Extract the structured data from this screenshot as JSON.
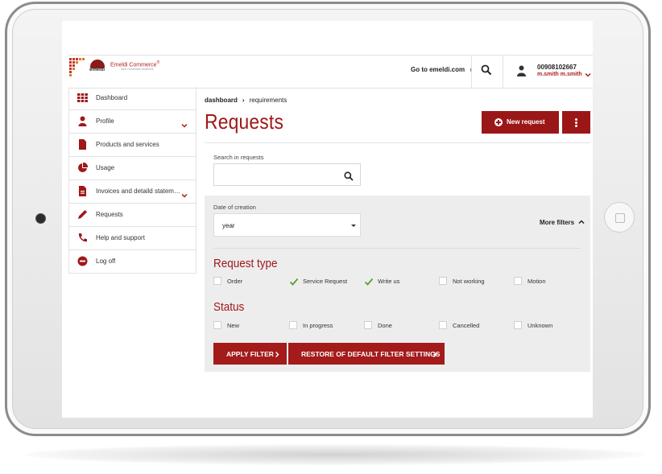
{
  "brand": {
    "name": "Emeldi Commerce",
    "registered": "®",
    "wordmark": "emeldi",
    "tagline": "Next Generation Business",
    "accent": "#a01818"
  },
  "header": {
    "goto_label": "Go to emeldi.com",
    "goto_arrow": "›",
    "user_phone": "00908102667",
    "user_name": "m.smith m.smith"
  },
  "sidebar": {
    "items": [
      {
        "label": "Dashboard",
        "icon": "grid-icon"
      },
      {
        "label": "Profile",
        "icon": "user-icon",
        "expandable": true
      },
      {
        "label": "Products and services",
        "icon": "document-icon"
      },
      {
        "label": "Usage",
        "icon": "pie-chart-icon"
      },
      {
        "label": "Invoices and detaild stateme...",
        "icon": "invoice-icon",
        "expandable": true
      },
      {
        "label": "Requests",
        "icon": "pencil-icon"
      },
      {
        "label": "Help and support",
        "icon": "phone-icon"
      },
      {
        "label": "Log off",
        "icon": "logoff-icon"
      }
    ]
  },
  "breadcrumb": {
    "root": "dashboard",
    "separator": "›",
    "current": "requirements"
  },
  "page": {
    "title": "Requests",
    "new_request_label": "New request"
  },
  "search": {
    "label": "Search in requests",
    "placeholder": "",
    "value": ""
  },
  "filters": {
    "date_label": "Date of creation",
    "date_value": "year",
    "more_filters_label": "More filters",
    "request_type_title": "Request type",
    "request_types": [
      {
        "label": "Order",
        "checked": false
      },
      {
        "label": "Service Request",
        "checked": true
      },
      {
        "label": "Write us",
        "checked": true
      },
      {
        "label": "Not working",
        "checked": false
      },
      {
        "label": "Motion",
        "checked": false
      }
    ],
    "status_title": "Status",
    "statuses": [
      {
        "label": "New",
        "checked": false
      },
      {
        "label": "In progress",
        "checked": false
      },
      {
        "label": "Done",
        "checked": false
      },
      {
        "label": "Cancelled",
        "checked": false
      },
      {
        "label": "Unknown",
        "checked": false
      }
    ],
    "apply_label": "APPLY FILTER",
    "restore_label": "RESTORE OF DEFAULT FILTER SETTINGS"
  },
  "colors": {
    "primary": "#9b1717",
    "check": "#5aa02c",
    "panel": "#ededed"
  }
}
